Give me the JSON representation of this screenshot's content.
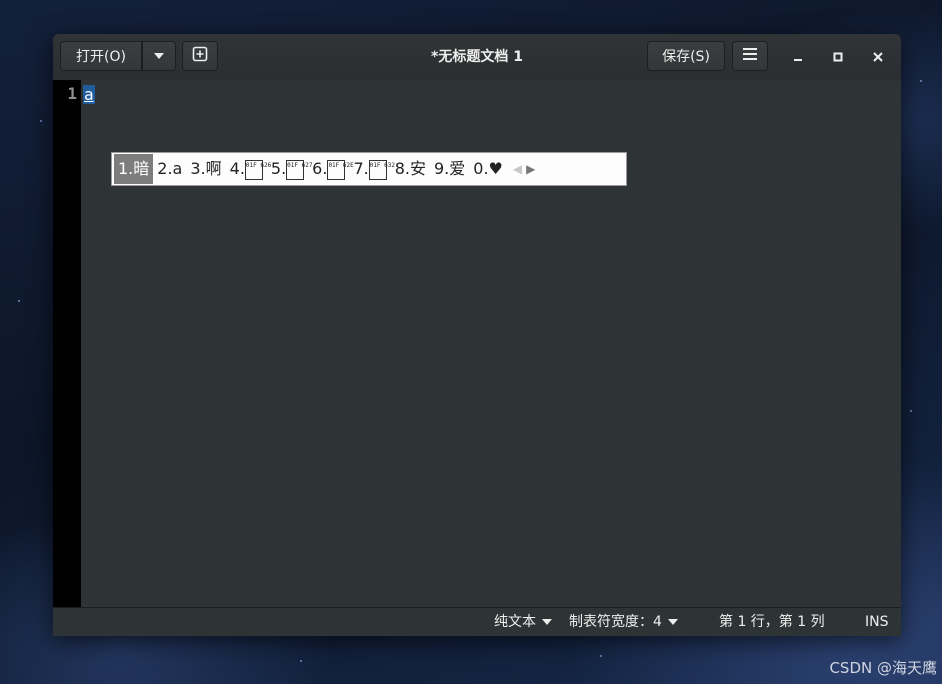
{
  "window": {
    "title": "*无标题文档 1"
  },
  "toolbar": {
    "open_label": "打开(O)",
    "open_menu_icon": "chevron-down-icon",
    "new_tab_icon": "new-document-icon",
    "save_label": "保存(S)",
    "menu_icon": "hamburger-menu-icon",
    "minimize_icon": "minimize-icon",
    "maximize_icon": "maximize-icon",
    "close_icon": "close-icon"
  },
  "editor": {
    "line_numbers": [
      "1"
    ],
    "lines": [
      "a"
    ],
    "preedit_text": "a"
  },
  "ime": {
    "candidates": [
      {
        "index": "1.",
        "text": "暗"
      },
      {
        "index": "2.",
        "text": "a"
      },
      {
        "index": "3.",
        "text": "啊"
      },
      {
        "index": "4.",
        "glyph_code": "01F 626"
      },
      {
        "index": "5.",
        "glyph_code": "01F 627"
      },
      {
        "index": "6.",
        "glyph_code": "01F 62E"
      },
      {
        "index": "7.",
        "glyph_code": "01F 632"
      },
      {
        "index": "8.",
        "text": "安"
      },
      {
        "index": "9.",
        "text": "爱"
      },
      {
        "index": "0.",
        "text": "♥"
      }
    ],
    "selected_index": 0
  },
  "statusbar": {
    "language": "纯文本",
    "tab_width": "制表符宽度：4",
    "position": "第 1 行，第 1 列",
    "mode": "INS"
  },
  "watermark": "CSDN @海天鹰"
}
